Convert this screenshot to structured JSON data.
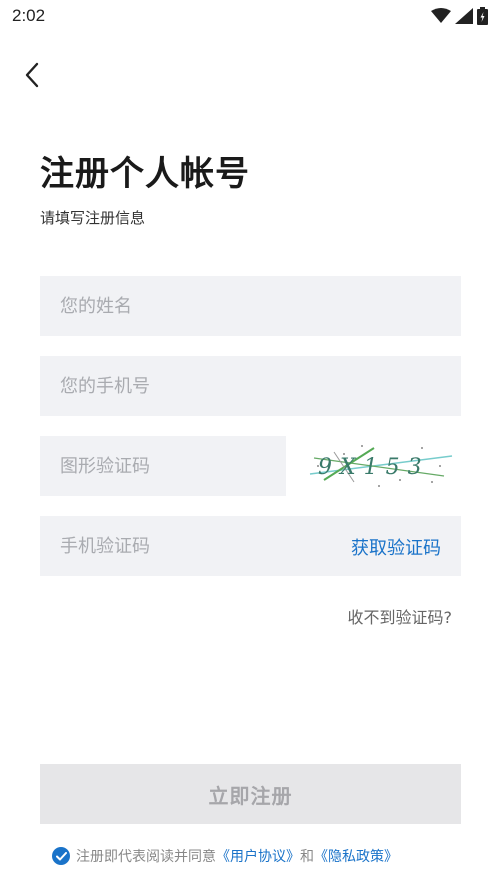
{
  "status_bar": {
    "time": "2:02",
    "icons": [
      "wifi-icon",
      "signal-icon",
      "battery-icon"
    ]
  },
  "nav": {
    "back_icon": "chevron-left-icon"
  },
  "header": {
    "title": "注册个人帐号",
    "subtitle": "请填写注册信息"
  },
  "form": {
    "name": {
      "placeholder": "您的姓名",
      "value": ""
    },
    "phone": {
      "placeholder": "您的手机号",
      "value": ""
    },
    "captcha": {
      "placeholder": "图形验证码",
      "value": "",
      "image_text": "9X153"
    },
    "sms": {
      "placeholder": "手机验证码",
      "value": "",
      "get_code_label": "获取验证码"
    },
    "no_code_label": "收不到验证码?"
  },
  "actions": {
    "register_label": "立即注册"
  },
  "agreement": {
    "checked": true,
    "prefix": "注册即代表阅读并同意",
    "user_agreement": "《用户协议》",
    "conjunction": "和",
    "privacy_policy": "《隐私政策》"
  },
  "colors": {
    "accent": "#1a73c9",
    "field_bg": "#f1f2f5",
    "button_disabled_bg": "#e6e6e8"
  }
}
